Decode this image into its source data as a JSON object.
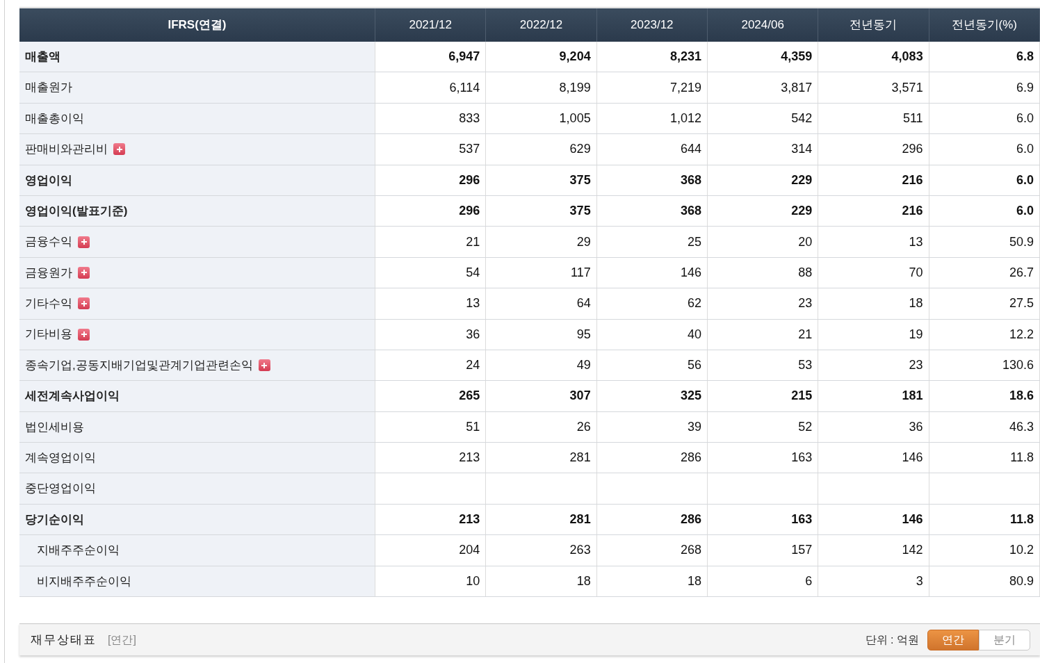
{
  "table": {
    "columns": [
      "IFRS(연결)",
      "2021/12",
      "2022/12",
      "2023/12",
      "2024/06",
      "전년동기",
      "전년동기(%)"
    ],
    "rows": [
      {
        "label": "매출액",
        "bold": true,
        "expandable": false,
        "values": [
          "6,947",
          "9,204",
          "8,231",
          "4,359",
          "4,083",
          "6.8"
        ]
      },
      {
        "label": "매출원가",
        "bold": false,
        "expandable": false,
        "values": [
          "6,114",
          "8,199",
          "7,219",
          "3,817",
          "3,571",
          "6.9"
        ]
      },
      {
        "label": "매출총이익",
        "bold": false,
        "expandable": false,
        "values": [
          "833",
          "1,005",
          "1,012",
          "542",
          "511",
          "6.0"
        ]
      },
      {
        "label": "판매비와관리비",
        "bold": false,
        "expandable": true,
        "values": [
          "537",
          "629",
          "644",
          "314",
          "296",
          "6.0"
        ]
      },
      {
        "label": "영업이익",
        "bold": true,
        "expandable": false,
        "values": [
          "296",
          "375",
          "368",
          "229",
          "216",
          "6.0"
        ]
      },
      {
        "label": "영업이익(발표기준)",
        "bold": true,
        "expandable": false,
        "values": [
          "296",
          "375",
          "368",
          "229",
          "216",
          "6.0"
        ]
      },
      {
        "label": "금융수익",
        "bold": false,
        "expandable": true,
        "values": [
          "21",
          "29",
          "25",
          "20",
          "13",
          "50.9"
        ]
      },
      {
        "label": "금융원가",
        "bold": false,
        "expandable": true,
        "values": [
          "54",
          "117",
          "146",
          "88",
          "70",
          "26.7"
        ]
      },
      {
        "label": "기타수익",
        "bold": false,
        "expandable": true,
        "values": [
          "13",
          "64",
          "62",
          "23",
          "18",
          "27.5"
        ]
      },
      {
        "label": "기타비용",
        "bold": false,
        "expandable": true,
        "values": [
          "36",
          "95",
          "40",
          "21",
          "19",
          "12.2"
        ]
      },
      {
        "label": "종속기업,공동지배기업및관계기업관련손익",
        "bold": false,
        "expandable": true,
        "values": [
          "24",
          "49",
          "56",
          "53",
          "23",
          "130.6"
        ]
      },
      {
        "label": "세전계속사업이익",
        "bold": true,
        "expandable": false,
        "values": [
          "265",
          "307",
          "325",
          "215",
          "181",
          "18.6"
        ]
      },
      {
        "label": "법인세비용",
        "bold": false,
        "expandable": false,
        "values": [
          "51",
          "26",
          "39",
          "52",
          "36",
          "46.3"
        ]
      },
      {
        "label": "계속영업이익",
        "bold": false,
        "expandable": false,
        "values": [
          "213",
          "281",
          "286",
          "163",
          "146",
          "11.8"
        ]
      },
      {
        "label": "중단영업이익",
        "bold": false,
        "expandable": false,
        "values": []
      },
      {
        "label": "당기순이익",
        "bold": true,
        "expandable": false,
        "values": [
          "213",
          "281",
          "286",
          "163",
          "146",
          "11.8"
        ],
        "children": [
          {
            "label": "지배주주순이익",
            "bold": false,
            "expandable": false,
            "values": [
              "204",
              "263",
              "268",
              "157",
              "142",
              "10.2"
            ]
          },
          {
            "label": "비지배주주순이익",
            "bold": false,
            "expandable": false,
            "values": [
              "10",
              "18",
              "18",
              "6",
              "3",
              "80.9"
            ]
          }
        ]
      }
    ]
  },
  "footer": {
    "title": "재무상태표",
    "period": "[연간]",
    "unit": "단위 : 억원",
    "toggle": [
      {
        "label": "연간",
        "selected": true
      },
      {
        "label": "분기",
        "selected": false
      }
    ]
  }
}
